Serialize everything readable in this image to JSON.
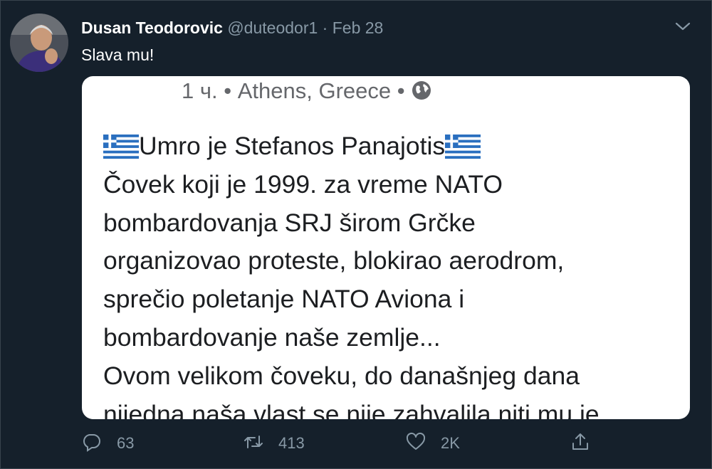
{
  "tweet": {
    "author_name": "Dusan Teodorovic",
    "author_handle": "@duteodor1",
    "separator": "·",
    "date": "Feb 28",
    "text": "Slava mu!"
  },
  "media": {
    "meta_time": "1 ч.",
    "meta_bullet": "•",
    "meta_location": "Athens, Greece",
    "meta_bullet_2": "•",
    "lines": [
      "Umro je Stefanos Panajotis",
      "Čovek koji je 1999. za vreme NATO",
      "bombardovanja SRJ širom Grčke",
      "organizovao proteste, blokirao aerodrom,",
      "sprečio poletanje NATO Aviona i",
      "bombardovanje naše zemlje...",
      "Ovom velikom čoveku, do današnjeg dana",
      "nijedna naša vlast se nije zahvalila niti mu je"
    ]
  },
  "actions": {
    "reply_count": "63",
    "retweet_count": "413",
    "like_count": "2K"
  },
  "icons": {
    "avatar": "avatar",
    "more": "chevron-down-icon",
    "globe": "globe-icon",
    "flag": "greek-flag-icon",
    "reply": "reply-icon",
    "retweet": "retweet-icon",
    "like": "heart-icon",
    "share": "share-icon"
  },
  "colors": {
    "background": "#15202b",
    "secondary_text": "#8899a6",
    "border": "#38444d"
  }
}
